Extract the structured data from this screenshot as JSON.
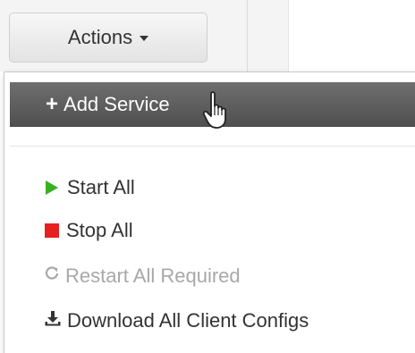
{
  "header": {
    "actions_label": "Actions"
  },
  "menu": {
    "add_service": "Add Service",
    "items": [
      {
        "label": "Start All",
        "icon": "play-icon",
        "color": "#38b020",
        "enabled": true
      },
      {
        "label": "Stop All",
        "icon": "stop-icon",
        "color": "#e5211f",
        "enabled": true
      },
      {
        "label": "Restart All Required",
        "icon": "restart-icon",
        "color": "#a8a8a8",
        "enabled": false
      },
      {
        "label": "Download All Client Configs",
        "icon": "download-icon",
        "color": "#333333",
        "enabled": true
      }
    ]
  }
}
